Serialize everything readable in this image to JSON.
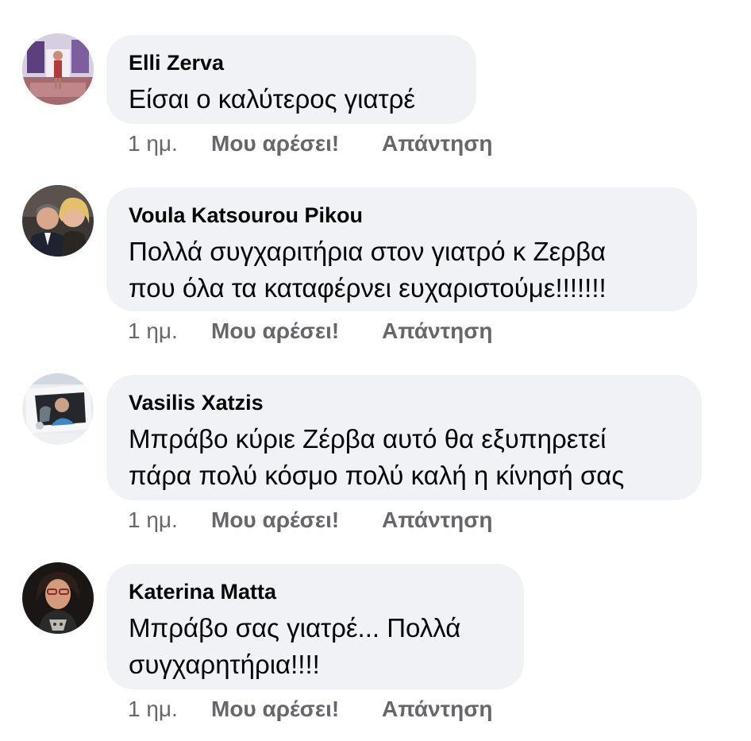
{
  "comments": [
    {
      "author": "Elli Zerva",
      "lines": [
        "Είσαι ο καλύτερος γιατρέ"
      ],
      "time": "1 ημ.",
      "like_label": "Μου αρέσει!",
      "reply_label": "Απάντηση",
      "avatar_icon": "profile-photo-woman-stage"
    },
    {
      "author": "Voula Katsourou Pikou",
      "lines": [
        "Πολλά συγχαριτήρια στον γιατρό κ Ζερβα",
        "που όλα τα καταφέρνει ευχαριστούμε!!!!!!!"
      ],
      "time": "1 ημ.",
      "like_label": "Μου αρέσει!",
      "reply_label": "Απάντηση",
      "avatar_icon": "profile-photo-couple"
    },
    {
      "author": "Vasilis Xatzis",
      "lines": [
        "Μπράβο κύριε Ζέρβα αυτό θα εξυπηρετεί",
        "πάρα πολύ κόσμο πολύ καλή η κίνησή σας"
      ],
      "time": "1 ημ.",
      "like_label": "Μου αρέσει!",
      "reply_label": "Απάντηση",
      "avatar_icon": "profile-photo-man-in-car"
    },
    {
      "author": "Katerina Matta",
      "lines": [
        "Μπράβο σας γιατρέ... Πολλά",
        "συγχαρητήρια!!!!"
      ],
      "time": "1 ημ.",
      "like_label": "Μου αρέσει!",
      "reply_label": "Απάντηση",
      "avatar_icon": "profile-photo-woman-glasses"
    }
  ],
  "colors": {
    "bubble_bg": "#f0f2f5",
    "author_text": "#050505",
    "meta_text": "#65676b"
  }
}
